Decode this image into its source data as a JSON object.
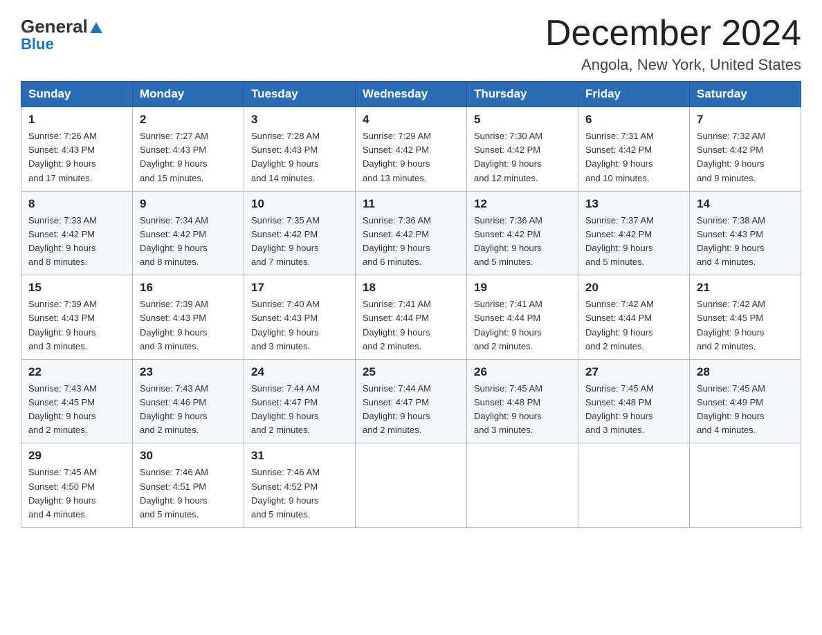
{
  "logo": {
    "general": "General",
    "blue_letter": "B",
    "blue_rest": "lue"
  },
  "header": {
    "title": "December 2024",
    "subtitle": "Angola, New York, United States"
  },
  "days_of_week": [
    "Sunday",
    "Monday",
    "Tuesday",
    "Wednesday",
    "Thursday",
    "Friday",
    "Saturday"
  ],
  "weeks": [
    [
      {
        "day": "1",
        "sunrise": "7:26 AM",
        "sunset": "4:43 PM",
        "daylight": "9 hours and 17 minutes."
      },
      {
        "day": "2",
        "sunrise": "7:27 AM",
        "sunset": "4:43 PM",
        "daylight": "9 hours and 15 minutes."
      },
      {
        "day": "3",
        "sunrise": "7:28 AM",
        "sunset": "4:43 PM",
        "daylight": "9 hours and 14 minutes."
      },
      {
        "day": "4",
        "sunrise": "7:29 AM",
        "sunset": "4:42 PM",
        "daylight": "9 hours and 13 minutes."
      },
      {
        "day": "5",
        "sunrise": "7:30 AM",
        "sunset": "4:42 PM",
        "daylight": "9 hours and 12 minutes."
      },
      {
        "day": "6",
        "sunrise": "7:31 AM",
        "sunset": "4:42 PM",
        "daylight": "9 hours and 10 minutes."
      },
      {
        "day": "7",
        "sunrise": "7:32 AM",
        "sunset": "4:42 PM",
        "daylight": "9 hours and 9 minutes."
      }
    ],
    [
      {
        "day": "8",
        "sunrise": "7:33 AM",
        "sunset": "4:42 PM",
        "daylight": "9 hours and 8 minutes."
      },
      {
        "day": "9",
        "sunrise": "7:34 AM",
        "sunset": "4:42 PM",
        "daylight": "9 hours and 8 minutes."
      },
      {
        "day": "10",
        "sunrise": "7:35 AM",
        "sunset": "4:42 PM",
        "daylight": "9 hours and 7 minutes."
      },
      {
        "day": "11",
        "sunrise": "7:36 AM",
        "sunset": "4:42 PM",
        "daylight": "9 hours and 6 minutes."
      },
      {
        "day": "12",
        "sunrise": "7:36 AM",
        "sunset": "4:42 PM",
        "daylight": "9 hours and 5 minutes."
      },
      {
        "day": "13",
        "sunrise": "7:37 AM",
        "sunset": "4:42 PM",
        "daylight": "9 hours and 5 minutes."
      },
      {
        "day": "14",
        "sunrise": "7:38 AM",
        "sunset": "4:43 PM",
        "daylight": "9 hours and 4 minutes."
      }
    ],
    [
      {
        "day": "15",
        "sunrise": "7:39 AM",
        "sunset": "4:43 PM",
        "daylight": "9 hours and 3 minutes."
      },
      {
        "day": "16",
        "sunrise": "7:39 AM",
        "sunset": "4:43 PM",
        "daylight": "9 hours and 3 minutes."
      },
      {
        "day": "17",
        "sunrise": "7:40 AM",
        "sunset": "4:43 PM",
        "daylight": "9 hours and 3 minutes."
      },
      {
        "day": "18",
        "sunrise": "7:41 AM",
        "sunset": "4:44 PM",
        "daylight": "9 hours and 2 minutes."
      },
      {
        "day": "19",
        "sunrise": "7:41 AM",
        "sunset": "4:44 PM",
        "daylight": "9 hours and 2 minutes."
      },
      {
        "day": "20",
        "sunrise": "7:42 AM",
        "sunset": "4:44 PM",
        "daylight": "9 hours and 2 minutes."
      },
      {
        "day": "21",
        "sunrise": "7:42 AM",
        "sunset": "4:45 PM",
        "daylight": "9 hours and 2 minutes."
      }
    ],
    [
      {
        "day": "22",
        "sunrise": "7:43 AM",
        "sunset": "4:45 PM",
        "daylight": "9 hours and 2 minutes."
      },
      {
        "day": "23",
        "sunrise": "7:43 AM",
        "sunset": "4:46 PM",
        "daylight": "9 hours and 2 minutes."
      },
      {
        "day": "24",
        "sunrise": "7:44 AM",
        "sunset": "4:47 PM",
        "daylight": "9 hours and 2 minutes."
      },
      {
        "day": "25",
        "sunrise": "7:44 AM",
        "sunset": "4:47 PM",
        "daylight": "9 hours and 2 minutes."
      },
      {
        "day": "26",
        "sunrise": "7:45 AM",
        "sunset": "4:48 PM",
        "daylight": "9 hours and 3 minutes."
      },
      {
        "day": "27",
        "sunrise": "7:45 AM",
        "sunset": "4:48 PM",
        "daylight": "9 hours and 3 minutes."
      },
      {
        "day": "28",
        "sunrise": "7:45 AM",
        "sunset": "4:49 PM",
        "daylight": "9 hours and 4 minutes."
      }
    ],
    [
      {
        "day": "29",
        "sunrise": "7:45 AM",
        "sunset": "4:50 PM",
        "daylight": "9 hours and 4 minutes."
      },
      {
        "day": "30",
        "sunrise": "7:46 AM",
        "sunset": "4:51 PM",
        "daylight": "9 hours and 5 minutes."
      },
      {
        "day": "31",
        "sunrise": "7:46 AM",
        "sunset": "4:52 PM",
        "daylight": "9 hours and 5 minutes."
      },
      null,
      null,
      null,
      null
    ]
  ],
  "labels": {
    "sunrise": "Sunrise:",
    "sunset": "Sunset:",
    "daylight": "Daylight:"
  }
}
